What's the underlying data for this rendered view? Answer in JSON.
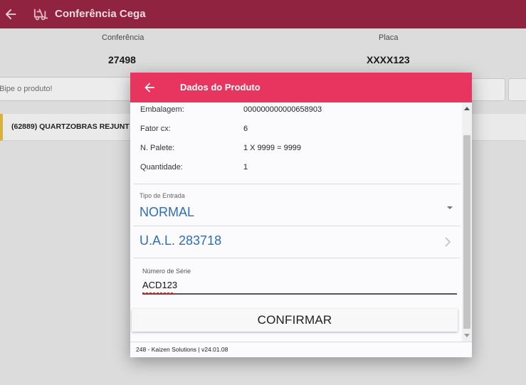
{
  "header": {
    "title": "Conferência Cega",
    "bg_color": "#8f2340",
    "back_icon": "arrow-left-icon",
    "logo_icon": "forklift-icon"
  },
  "info": {
    "conferencia_label": "Conferência",
    "conferencia_value": "27498",
    "placa_label": "Placa",
    "placa_value": "XXXX123"
  },
  "scan": {
    "placeholder": "Bipe o produto!"
  },
  "product_row": {
    "text": "(62889) QUARTZOBRAS REJUNT"
  },
  "modal": {
    "title": "Dados do Produto",
    "header_color": "#e8355f",
    "details": [
      {
        "label": "Embalagem:",
        "value": "000000000000658903"
      },
      {
        "label": "Fator cx:",
        "value": "6"
      },
      {
        "label": "N. Palete:",
        "value": "1 X 9999 = 9999"
      },
      {
        "label": "Quantidade:",
        "value": "1"
      }
    ],
    "tipo_entrada": {
      "label": "Tipo de Entrada",
      "value": "NORMAL"
    },
    "ual": {
      "value": "U.A.L. 283718"
    },
    "serial": {
      "label": "Número de Série",
      "value": "ACD123"
    },
    "confirm_label": "CONFIRMAR",
    "footer": "248 - Kaizen Solutions  |  v24.01.08"
  }
}
